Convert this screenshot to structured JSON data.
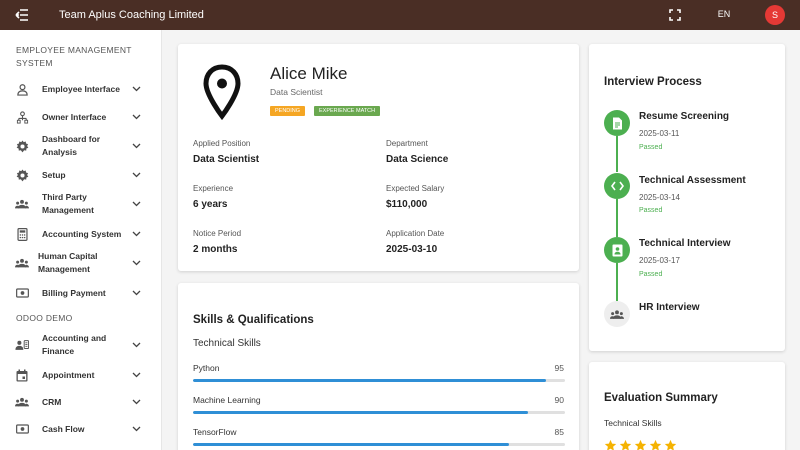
{
  "topbar": {
    "title": "Team Aplus Coaching Limited",
    "lang": "EN",
    "avatar_initial": "S"
  },
  "sidebar": {
    "section1": "Employee Management System",
    "items1": [
      {
        "label": "Employee Interface",
        "icon": "person-icon"
      },
      {
        "label": "Owner Interface",
        "icon": "org-chart-icon"
      },
      {
        "label": "Dashboard for Analysis",
        "icon": "gear-icon"
      },
      {
        "label": "Setup",
        "icon": "gear-icon"
      },
      {
        "label": "Third Party Management",
        "icon": "group-icon"
      },
      {
        "label": "Accounting System",
        "icon": "calculator-icon"
      },
      {
        "label": "Human Capital Management",
        "icon": "group-icon"
      },
      {
        "label": "Billing Payment",
        "icon": "money-icon"
      }
    ],
    "section2": "ODOO DEMO",
    "items2": [
      {
        "label": "Accounting and Finance",
        "icon": "contact-icon"
      },
      {
        "label": "Appointment",
        "icon": "calendar-icon"
      },
      {
        "label": "CRM",
        "icon": "group-icon"
      },
      {
        "label": "Cash Flow",
        "icon": "money-icon"
      }
    ]
  },
  "profile": {
    "name": "Alice Mike",
    "role": "Data Scientist",
    "badges": [
      {
        "label": "Pending",
        "color": "#f5a623"
      },
      {
        "label": "Experience Match",
        "color": "#6aa84f"
      }
    ],
    "fields": [
      {
        "label": "Applied Position",
        "value": "Data Scientist"
      },
      {
        "label": "Department",
        "value": "Data Science"
      },
      {
        "label": "Experience",
        "value": "6 years"
      },
      {
        "label": "Expected Salary",
        "value": "$110,000"
      },
      {
        "label": "Notice Period",
        "value": "2 months"
      },
      {
        "label": "Application Date",
        "value": "2025-03-10"
      }
    ]
  },
  "skills": {
    "title": "Skills & Qualifications",
    "subtitle": "Technical Skills",
    "items": [
      {
        "name": "Python",
        "value": "95",
        "level": 0.95
      },
      {
        "name": "Machine Learning",
        "value": "90",
        "level": 0.9
      },
      {
        "name": "TensorFlow",
        "value": "85",
        "level": 0.85
      }
    ]
  },
  "interview": {
    "title": "Interview Process",
    "steps": [
      {
        "name": "Resume Screening",
        "date": "2025-03-11",
        "status": "Passed",
        "icon": "document-icon"
      },
      {
        "name": "Technical Assessment",
        "date": "2025-03-14",
        "status": "Passed",
        "icon": "code-icon"
      },
      {
        "name": "Technical Interview",
        "date": "2025-03-17",
        "status": "Passed",
        "icon": "badge-person-icon"
      },
      {
        "name": "HR Interview",
        "icon": "group-icon"
      }
    ]
  },
  "evaluation": {
    "title": "Evaluation Summary",
    "subtitle": "Technical Skills",
    "rating": 5,
    "star_color": "#f5b301"
  },
  "colors": {
    "topbar": "#4a2e25",
    "accent_green": "#4caf50",
    "bar_blue": "#2f8fd6"
  }
}
